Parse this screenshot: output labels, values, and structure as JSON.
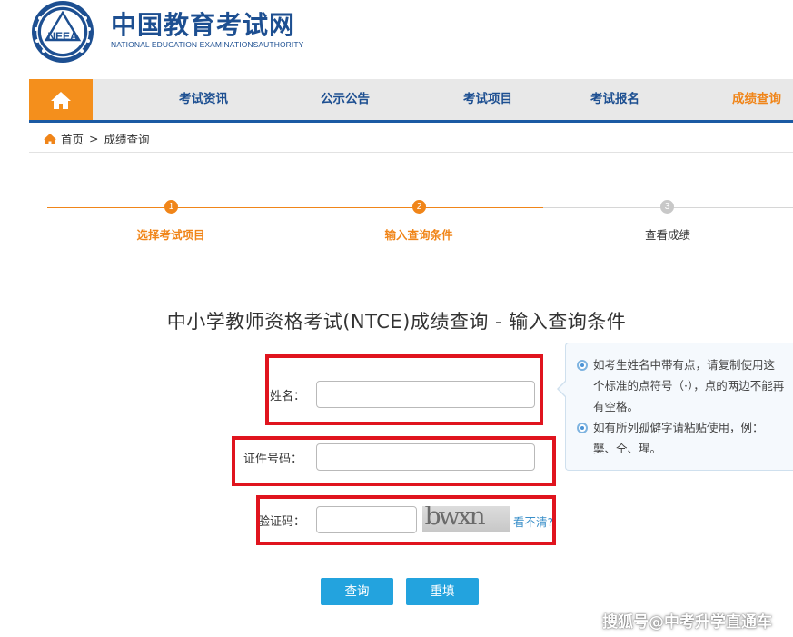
{
  "header": {
    "logo_text": "NEEA",
    "title": "中国教育考试网",
    "subtitle": "NATIONAL EDUCATION EXAMINATIONSAUTHORITY"
  },
  "nav": {
    "home_icon": "home-icon",
    "items": [
      {
        "label": "考试资讯",
        "active": false
      },
      {
        "label": "公示公告",
        "active": false
      },
      {
        "label": "考试项目",
        "active": false
      },
      {
        "label": "考试报名",
        "active": false
      },
      {
        "label": "成绩查询",
        "active": true
      }
    ]
  },
  "breadcrumb": {
    "home_icon": "home-icon",
    "home": "首页",
    "separator": ">",
    "current": "成绩查询"
  },
  "steps": [
    {
      "num": "1",
      "label": "选择考试项目",
      "done": true
    },
    {
      "num": "2",
      "label": "输入查询条件",
      "done": true
    },
    {
      "num": "3",
      "label": "查看成绩",
      "done": false
    }
  ],
  "form": {
    "title": "中小学教师资格考试(NTCE)成绩查询 - 输入查询条件",
    "name_label": "姓名：",
    "name_value": "",
    "id_label": "证件号码：",
    "id_value": "",
    "captcha_label": "验证码：",
    "captcha_value": "",
    "captcha_image_text": "bwxn",
    "captcha_refresh": "看不清?",
    "submit": "查询",
    "reset": "重填"
  },
  "tips": [
    "如考生姓名中带有点，请复制使用这个标准的点符号（·），点的两边不能再有空格。",
    "如有所列孤僻字请粘贴使用，例：龑、仝、瑆。"
  ],
  "watermark": "搜狐号@中考升学直通车",
  "colors": {
    "brand_blue": "#1d4f91",
    "accent_orange": "#f08519",
    "button_blue": "#23a3de",
    "highlight_red": "#e0141e"
  }
}
